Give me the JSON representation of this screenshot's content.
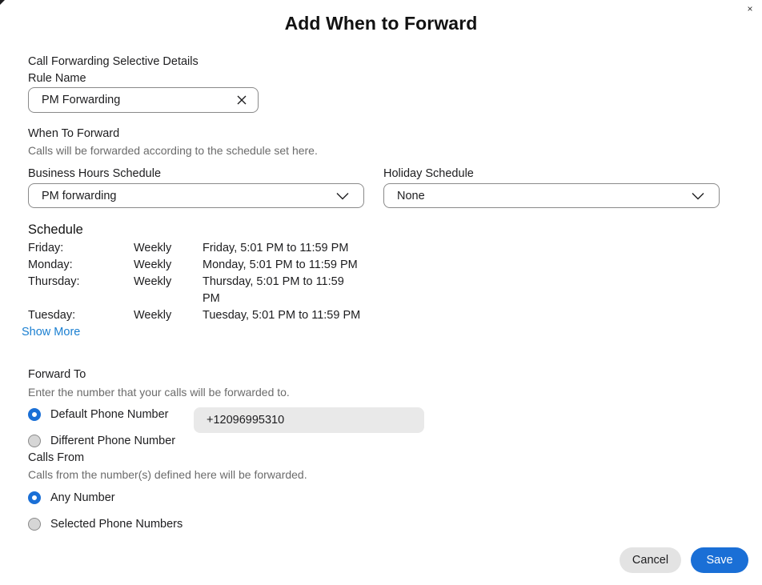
{
  "dialog": {
    "title": "Add When to Forward",
    "close_label": "×"
  },
  "details": {
    "section_label": "Call Forwarding Selective Details",
    "rule_name_label": "Rule Name",
    "rule_name_value": "PM Forwarding"
  },
  "when": {
    "label": "When To Forward",
    "helper": "Calls will be forwarded according to the schedule set here.",
    "business_label": "Business Hours Schedule",
    "business_value": "PM forwarding",
    "holiday_label": "Holiday Schedule",
    "holiday_value": "None"
  },
  "schedule": {
    "title": "Schedule",
    "rows": [
      {
        "day": "Friday:",
        "freq": "Weekly",
        "range": "Friday, 5:01 PM to 11:59 PM"
      },
      {
        "day": "Monday:",
        "freq": "Weekly",
        "range": "Monday, 5:01 PM to 11:59 PM"
      },
      {
        "day": "Thursday:",
        "freq": "Weekly",
        "range": "Thursday, 5:01 PM to 11:59 PM"
      },
      {
        "day": "Tuesday:",
        "freq": "Weekly",
        "range": "Tuesday, 5:01 PM to 11:59 PM"
      }
    ],
    "show_more": "Show More"
  },
  "forward_to": {
    "label": "Forward To",
    "helper": "Enter the number that your calls will be forwarded to.",
    "option_default": "Default Phone Number",
    "option_different": "Different Phone Number",
    "default_number": "+12096995310",
    "selected": "default"
  },
  "calls_from": {
    "label": "Calls From",
    "helper": "Calls from the number(s) defined here will be forwarded.",
    "option_any": "Any Number",
    "option_selected": "Selected Phone Numbers",
    "selected": "any"
  },
  "footer": {
    "cancel_label": "Cancel",
    "save_label": "Save"
  },
  "colors": {
    "accent": "#1a6fd6",
    "link": "#1a7fd1"
  }
}
